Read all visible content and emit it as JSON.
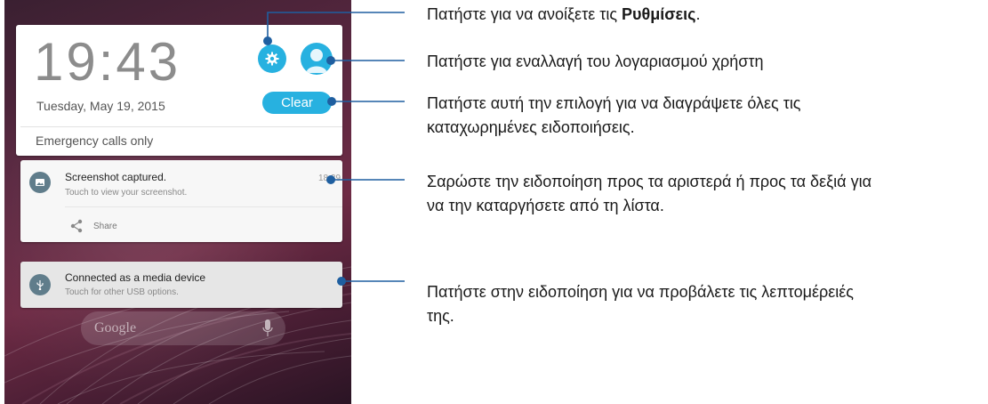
{
  "lockscreen": {
    "clock": "19:43",
    "date": "Tuesday, May 19, 2015",
    "clear_label": "Clear",
    "emergency": "Emergency calls only",
    "accent_color": "#27b1e0"
  },
  "notifications": [
    {
      "title": "Screenshot captured.",
      "subtitle": "Touch to view your screenshot.",
      "time": "18:39",
      "icon": "image-icon",
      "action_label": "Share",
      "action_icon": "share-icon"
    },
    {
      "title": "Connected as a media device",
      "subtitle": "Touch for other USB options.",
      "icon": "usb-icon"
    }
  ],
  "homescreen": {
    "search_placeholder": "Google",
    "mic_icon": "mic-icon"
  },
  "callouts": {
    "settings_prefix": "Πατήστε για να ανοίξετε τις ",
    "settings_bold": "Ρυθμίσεις",
    "settings_suffix": ".",
    "switch_user": "Πατήστε για εναλλαγή του λογαριασμού χρήστη",
    "clear_line1": "Πατήστε αυτή την επιλογή για να διαγράψετε όλες τις",
    "clear_line2": "καταχωρημένες ειδοποιήσεις.",
    "swipe_line1": "Σαρώστε την ειδοποίηση προς τα αριστερά ή προς τα δεξιά για",
    "swipe_line2": "να την καταργήσετε από τη λίστα.",
    "tap_line1": "Πατήστε στην ειδοποίηση για να προβάλετε τις λεπτομέρειές",
    "tap_line2": "της."
  },
  "callout_line_color": "#1f5fa0"
}
